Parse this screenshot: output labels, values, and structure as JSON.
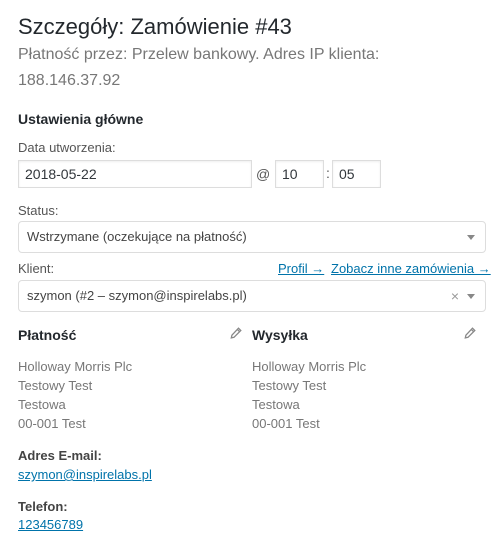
{
  "page": {
    "title": "Szczegóły: Zamówienie #43",
    "subtitle": "Płatność przez: Przelew bankowy. Adres IP klienta: 188.146.37.92"
  },
  "general": {
    "section_title": "Ustawienia główne",
    "date_label": "Data utworzenia:",
    "date_value": "2018-05-22",
    "at_symbol": "@",
    "hour_value": "10",
    "colon": ":",
    "minute_value": "05",
    "status_label": "Status:",
    "status_value": "Wstrzymane (oczekujące na płatność)",
    "client_label": "Klient:",
    "profile_link": "Profil →",
    "other_orders_link": "Zobacz inne zamówienia →",
    "client_value": "szymon (#2 – szymon@inspirelabs.pl)",
    "clear_symbol": "×"
  },
  "billing": {
    "heading": "Płatność",
    "lines": [
      "Holloway Morris Plc",
      "Testowy Test",
      "Testowa",
      "00-001 Test"
    ],
    "email_label": "Adres E-mail:",
    "email_value": "szymon@inspirelabs.pl",
    "phone_label": "Telefon:",
    "phone_value": "123456789"
  },
  "shipping": {
    "heading": "Wysyłka",
    "lines": [
      "Holloway Morris Plc",
      "Testowy Test",
      "Testowa",
      "00-001 Test"
    ]
  },
  "icons": {
    "edit_billing": "pencil-icon",
    "edit_shipping": "pencil-icon"
  }
}
